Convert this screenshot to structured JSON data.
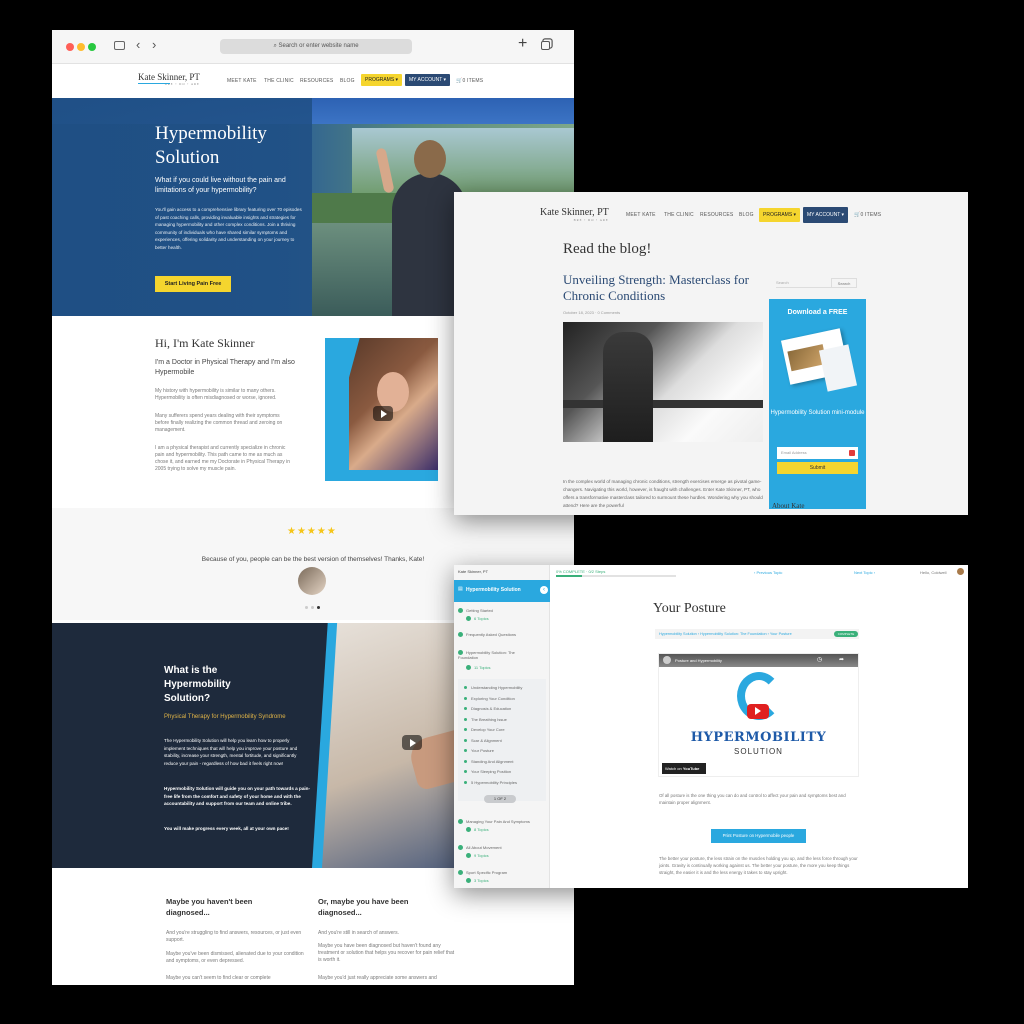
{
  "browser": {
    "url_placeholder": "Search or enter website name",
    "new_tab_icon": "plus-icon",
    "tabs_icon": "tabs-icon"
  },
  "colors": {
    "navy": "#2b4a74",
    "yellow": "#f5d52e",
    "cyan": "#2aa8df",
    "dark": "#1e2a3c",
    "green": "#3ab07a"
  },
  "site": {
    "logo": "Kate Skinner, PT",
    "logo_sub": "BRE • DO • ARE",
    "nav": [
      "MEET KATE",
      "THE CLINIC",
      "RESOURCES",
      "BLOG"
    ],
    "programs": "PROGRAMS ▾",
    "account": "MY ACCOUNT ▾",
    "cart": "0 ITEMS"
  },
  "hero": {
    "title_line1": "Hypermobility",
    "title_line2": "Solution",
    "subtitle": "What if you could live without the pain and limitations of your hypermobility?",
    "body": "You'll gain access to a comprehensive library featuring over 70 episodes of past coaching calls, providing invaluable insights and strategies for managing hypermobility and other complex conditions. Join a thriving community of individuals who have shared similar symptoms and experiences, offering solidarity and understanding on your journey to better health.",
    "cta": "Start Living Pain Free"
  },
  "intro": {
    "title": "Hi, I'm Kate Skinner",
    "subtitle": "I'm a Doctor in Physical Therapy and I'm also Hypermobile",
    "p1": "My history with hypermobility is similar to many others. Hypermobility is often misdiagnosed or worse, ignored.",
    "p2": "Many sufferers spend years dealing with their symptoms before finally realizing the common thread and zeroing on management.",
    "p3": "I am a physical therapist and currently specialize in chronic pain and hypermobility. This path came to me as much as chose it, and earned me my Doctorate in Physical Therapy in 2005 trying to solve my muscle pain."
  },
  "testimonial": {
    "stars": "★★★★★",
    "quote": "Because of you, people can be the best version of themselves! Thanks, Kate!"
  },
  "what": {
    "title": "What is the Hypermobility Solution?",
    "subtitle": "Physical Therapy for Hypermobility Syndrome",
    "p1": "The Hypermobility Solution will help you learn how to properly implement techniques that will help you improve your posture and stability, increase your strength, mental fortitude, and significantly reduce your pain - regardless of how bad it feels right now!",
    "p2": "Hypermobility Solution will guide you on your path towards a pain-free life from the comfort and safety of your home and with the accountability and support from our team and online tribe.",
    "p3": "You will make progress every week, all at your own pace!"
  },
  "columns": {
    "left_title": "Maybe you haven't been diagnosed...",
    "left_p1": "And you're struggling to find answers, resources, or just even support.",
    "left_p2": "Maybe you've been dismissed, alienated due to your condition and symptoms, or even depressed.",
    "left_p3": "Maybe you can't seem to find clear or complete",
    "right_title": "Or, maybe you have been diagnosed...",
    "right_p1": "And you're still in search of answers.",
    "right_p2": "Maybe you have been diagnosed but haven't found any treatment or solution that helps you recover for pain relief that is worth it.",
    "right_p3": "Maybe you'd just really appreciate some answers and"
  },
  "blog": {
    "heading": "Read the blog!",
    "post_title": "Unveiling Strength: Masterclass for Chronic Conditions",
    "meta": "October 18, 2023 · 0 Comments",
    "excerpt": "In the complex world of managing chronic conditions, strength exercises emerge as pivotal game-changers. Navigating this world, however, is fraught with challenges. Enter Kate Skinner, PT, who offers a transformative masterclass tailored to surmount these hurdles. Wondering why you should attend? Here are the powerful",
    "search_placeholder": "Search",
    "search_btn": "Search",
    "promo_title": "Download a FREE",
    "promo_body": "Hypermobility Solution mini-module",
    "email_placeholder": "Email Address",
    "submit": "Submit",
    "about": "About Kate"
  },
  "course": {
    "brand": "Kate Skinner, PT",
    "progress_label": "0% COMPLETE · 0/2 Steps",
    "progress": 0.22,
    "prev": "‹ Previous Topic",
    "next": "Next Topic ›",
    "user": "Hello, Coldwell",
    "sidebar_title": "Hypermobility Solution",
    "modules": [
      {
        "title": "Getting Started",
        "sub": "6 Topics"
      },
      {
        "title": "Frequently Asked Questions",
        "sub": ""
      },
      {
        "title": "Hypermobility Solution: The Foundation",
        "sub": "11 Topics"
      }
    ],
    "lessons": [
      "Understanding Hypermobility",
      "Exploring Your Condition",
      "Diagnosis & Education",
      "The Breathing Issue",
      "Develop Your Core",
      "Scar & Alignment",
      "Your Posture",
      "Standing And Alignment",
      "Your Sleeping Position",
      "5 Hypermobility Principles"
    ],
    "pager": "1 OF 2",
    "modules_after": [
      {
        "title": "Managing Your Pain And Symptoms",
        "sub": "8 Topics"
      },
      {
        "title": "All About Movement",
        "sub": "9 Topics"
      },
      {
        "title": "Sport Specific Program",
        "sub": "3 Topics"
      }
    ],
    "lesson_title": "Your Posture",
    "breadcrumb": "Hypermobility Solution › Hypermobility Solution: The Foundation › Your Posture",
    "status": "COMPLETE",
    "video_title": "Posture and Hypermobility",
    "brand_big": "HYPERMOBILITY",
    "brand_small": "SOLUTION",
    "watch_on": "Watch on",
    "youtube": "YouTube",
    "p1": "Of all posture is the one thing you can do and control to affect your pain and symptoms best and maintain proper alignment.",
    "print_btn": "Print Posture on Hypermobile people",
    "p2": "The better your posture, the less strain on the muscles holding you up, and the less force through your joints. Gravity is continually working against us. The better your posture, the more you keep things straight, the easier it is and the less energy it takes to stay upright."
  }
}
